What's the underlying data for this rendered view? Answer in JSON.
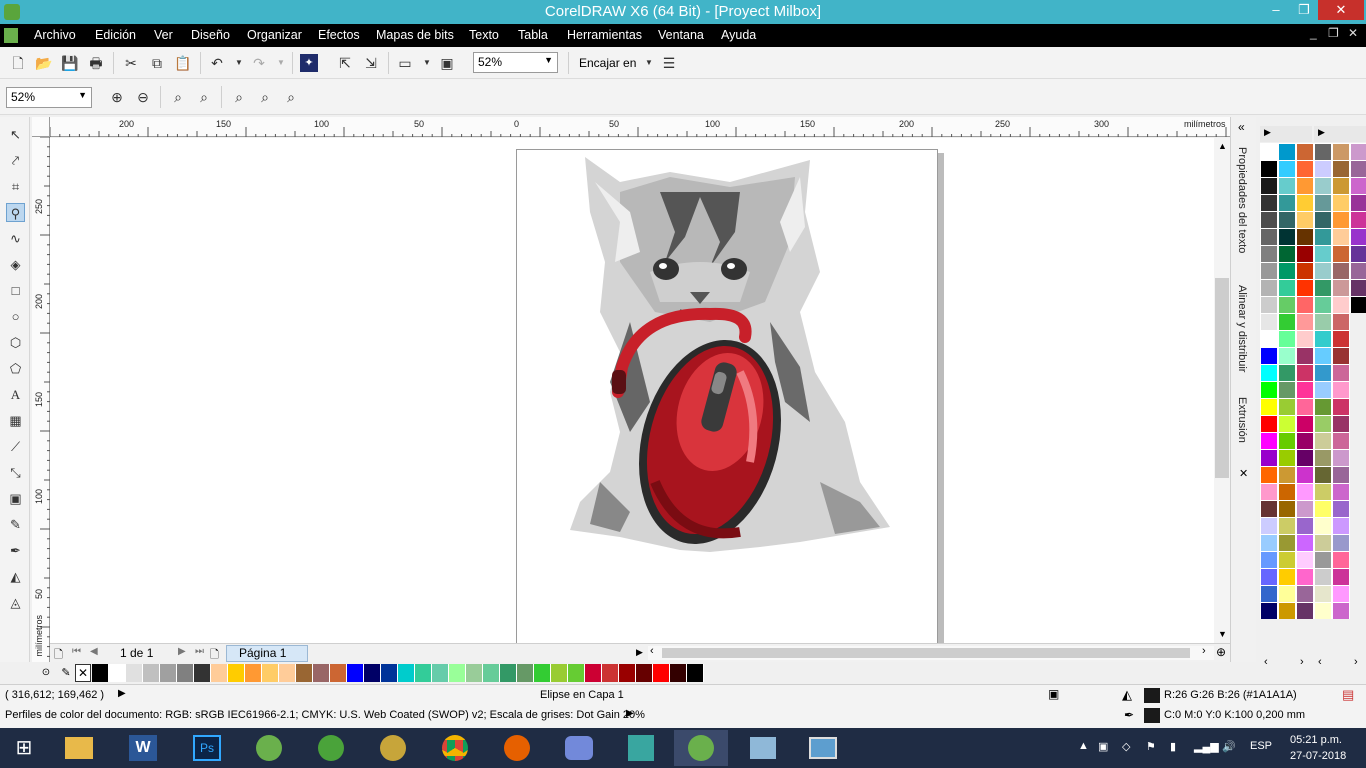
{
  "window": {
    "title": "CorelDRAW X6 (64 Bit) - [Proyect Milbox]",
    "minimize": "–",
    "maximize": "❐",
    "close": "✕"
  },
  "menu": {
    "items": [
      "Archivo",
      "Edición",
      "Ver",
      "Diseño",
      "Organizar",
      "Efectos",
      "Mapas de bits",
      "Texto",
      "Tabla",
      "Herramientas",
      "Ventana",
      "Ayuda"
    ],
    "doc_controls": [
      "_",
      "❐",
      "✕"
    ]
  },
  "toolbar1": {
    "zoom_value": "52%",
    "snap_label": "Encajar en"
  },
  "toolbar2": {
    "zoom_value": "52%"
  },
  "ruler": {
    "h_labels": [
      "200",
      "150",
      "100",
      "50",
      "0",
      "50",
      "100",
      "150",
      "200",
      "250",
      "300"
    ],
    "unit": "milímetros",
    "v_labels": [
      "250",
      "200",
      "150",
      "100",
      "50"
    ],
    "v_unit": "milímetros"
  },
  "page_nav": {
    "counter": "1 de 1",
    "page_tab": "Página 1"
  },
  "dockers": {
    "tabs": [
      "Propiedades del texto",
      "Alinear y distribuir",
      "Extrusión"
    ]
  },
  "status": {
    "coords": "( 316,612; 169,462 )",
    "selection": "Elipse en Capa 1",
    "fill_color": "R:26 G:26 B:26 (#1A1A1A)",
    "outline": "C:0 M:0 Y:0 K:100  0,200 mm",
    "color_profile": "Perfiles de color del documento: RGB: sRGB IEC61966-2.1; CMYK: U.S. Web Coated (SWOP) v2; Escala de grises: Dot Gain 20%"
  },
  "taskbar": {
    "lang": "ESP",
    "time": "05:21 p.m.",
    "date": "27-07-2018"
  },
  "colors": {
    "titlebar": "#41b4c8",
    "palette_right_1": [
      "#ffffff",
      "#000000",
      "#1a1a1a",
      "#333333",
      "#4d4d4d",
      "#666666",
      "#808080",
      "#999999",
      "#b3b3b3",
      "#cccccc",
      "#e6e6e6",
      "#ffffff",
      "#0000ff",
      "#00ffff",
      "#00ff00",
      "#ffff00",
      "#ff0000",
      "#ff00ff",
      "#9900cc",
      "#ff6600",
      "#ff99cc",
      "#663333",
      "#ccccff",
      "#99ccff",
      "#6699ff",
      "#6666ff",
      "#3366cc",
      "#000066"
    ],
    "palette_right_2": [
      "#0099cc",
      "#33ccff",
      "#66cccc",
      "#339999",
      "#336666",
      "#003333",
      "#006633",
      "#009966",
      "#33cc99",
      "#66cc66",
      "#33cc33",
      "#66ff99",
      "#99ffcc",
      "#339966",
      "#669966",
      "#99cc33",
      "#ccff33",
      "#66cc00",
      "#99cc00",
      "#cc9933",
      "#cc6600",
      "#996600",
      "#cccc66",
      "#999933",
      "#cccc33",
      "#ffcc00",
      "#ffff99",
      "#cc9900"
    ],
    "palette_right_3": [
      "#cc6633",
      "#ff6633",
      "#ff9933",
      "#ffcc33",
      "#ffcc66",
      "#663300",
      "#990000",
      "#cc3300",
      "#ff3300",
      "#ff6666",
      "#ff9999",
      "#ffcccc",
      "#993366",
      "#cc3366",
      "#ff3399",
      "#ff6699",
      "#cc0066",
      "#990066",
      "#660066",
      "#cc33cc",
      "#ff99ff",
      "#cc99cc",
      "#9966cc",
      "#cc66ff",
      "#ffccff",
      "#ff66cc",
      "#996699",
      "#663366"
    ],
    "palette_right_4": [
      "#666666",
      "#ccccff",
      "#99cccc",
      "#669999",
      "#336666",
      "#339999",
      "#66cccc",
      "#99cccc",
      "#339966",
      "#66cc99",
      "#99ccaa",
      "#33cccc",
      "#66ccff",
      "#3399cc",
      "#99ccff",
      "#669933",
      "#99cc66",
      "#cccc99",
      "#999966",
      "#666633",
      "#cccc66",
      "#ffff66",
      "#ffffcc",
      "#cccc99",
      "#999999",
      "#cccccc",
      "#e6e6cc",
      "#ffffcc"
    ],
    "palette_right_5": [
      "#cc9966",
      "#996633",
      "#cc9933",
      "#ffcc66",
      "#ff9933",
      "#ffcc99",
      "#cc6633",
      "#996666",
      "#cc9999",
      "#ffcccc",
      "#cc6666",
      "#cc3333",
      "#993333",
      "#cc6699",
      "#ff99cc",
      "#cc3366",
      "#993366",
      "#cc6699",
      "#cc99cc",
      "#996699",
      "#cc66cc",
      "#9966cc",
      "#cc99ff",
      "#9999cc",
      "#ff6699",
      "#cc3399",
      "#ff99ff",
      "#cc66cc"
    ],
    "palette_right_6": [
      "#cc99cc",
      "#996699",
      "#cc66cc",
      "#993399",
      "#cc3399",
      "#9933cc",
      "#663399",
      "#996699",
      "#663366",
      "#000000"
    ],
    "palette_bottom": [
      "#000000",
      "#ffffff",
      "#e0e0e0",
      "#c0c0c0",
      "#a0a0a0",
      "#808080",
      "#333333",
      "#ffcc99",
      "#ffcc00",
      "#ff9933",
      "#ffcc66",
      "#ffcc99",
      "#996633",
      "#996666",
      "#cc6633",
      "#0000ff",
      "#000066",
      "#003399",
      "#00cccc",
      "#33cc99",
      "#66ccaa",
      "#99ff99",
      "#99cc99",
      "#66cc99",
      "#339966",
      "#669966",
      "#33cc33",
      "#99cc33",
      "#66cc33",
      "#cc0033",
      "#cc3333",
      "#990000",
      "#660000",
      "#ff0000",
      "#330000",
      "#000000"
    ]
  }
}
